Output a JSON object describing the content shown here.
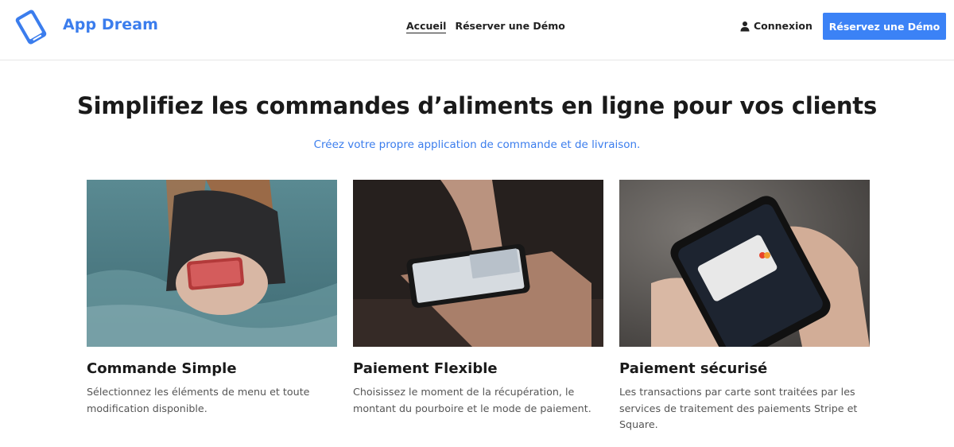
{
  "header": {
    "brand": "App Dream",
    "nav": [
      {
        "label": "Accueil"
      },
      {
        "label": "Réserver une Démo"
      }
    ],
    "login_label": "Connexion",
    "cta_label": "Réservez une Démo"
  },
  "hero": {
    "title": "Simplifiez les commandes d’aliments en ligne pour vos clients",
    "subtitle": "Créez votre propre application de commande et de livraison."
  },
  "features": [
    {
      "title": "Commande Simple",
      "description": "Sélectionnez les éléments de menu et toute modification disponible."
    },
    {
      "title": "Paiement Flexible",
      "description": "Choisissez le moment de la récupération, le montant du pourboire et le mode de paiement."
    },
    {
      "title": "Paiement sécurisé",
      "description": "Les transactions par carte sont traitées par les services de traitement des paiements Stripe et Square."
    }
  ],
  "colors": {
    "accent": "#3b82f6",
    "brand": "#3b7ded"
  },
  "icons": {
    "logo": "tablet-logo-icon",
    "login": "user-icon"
  }
}
